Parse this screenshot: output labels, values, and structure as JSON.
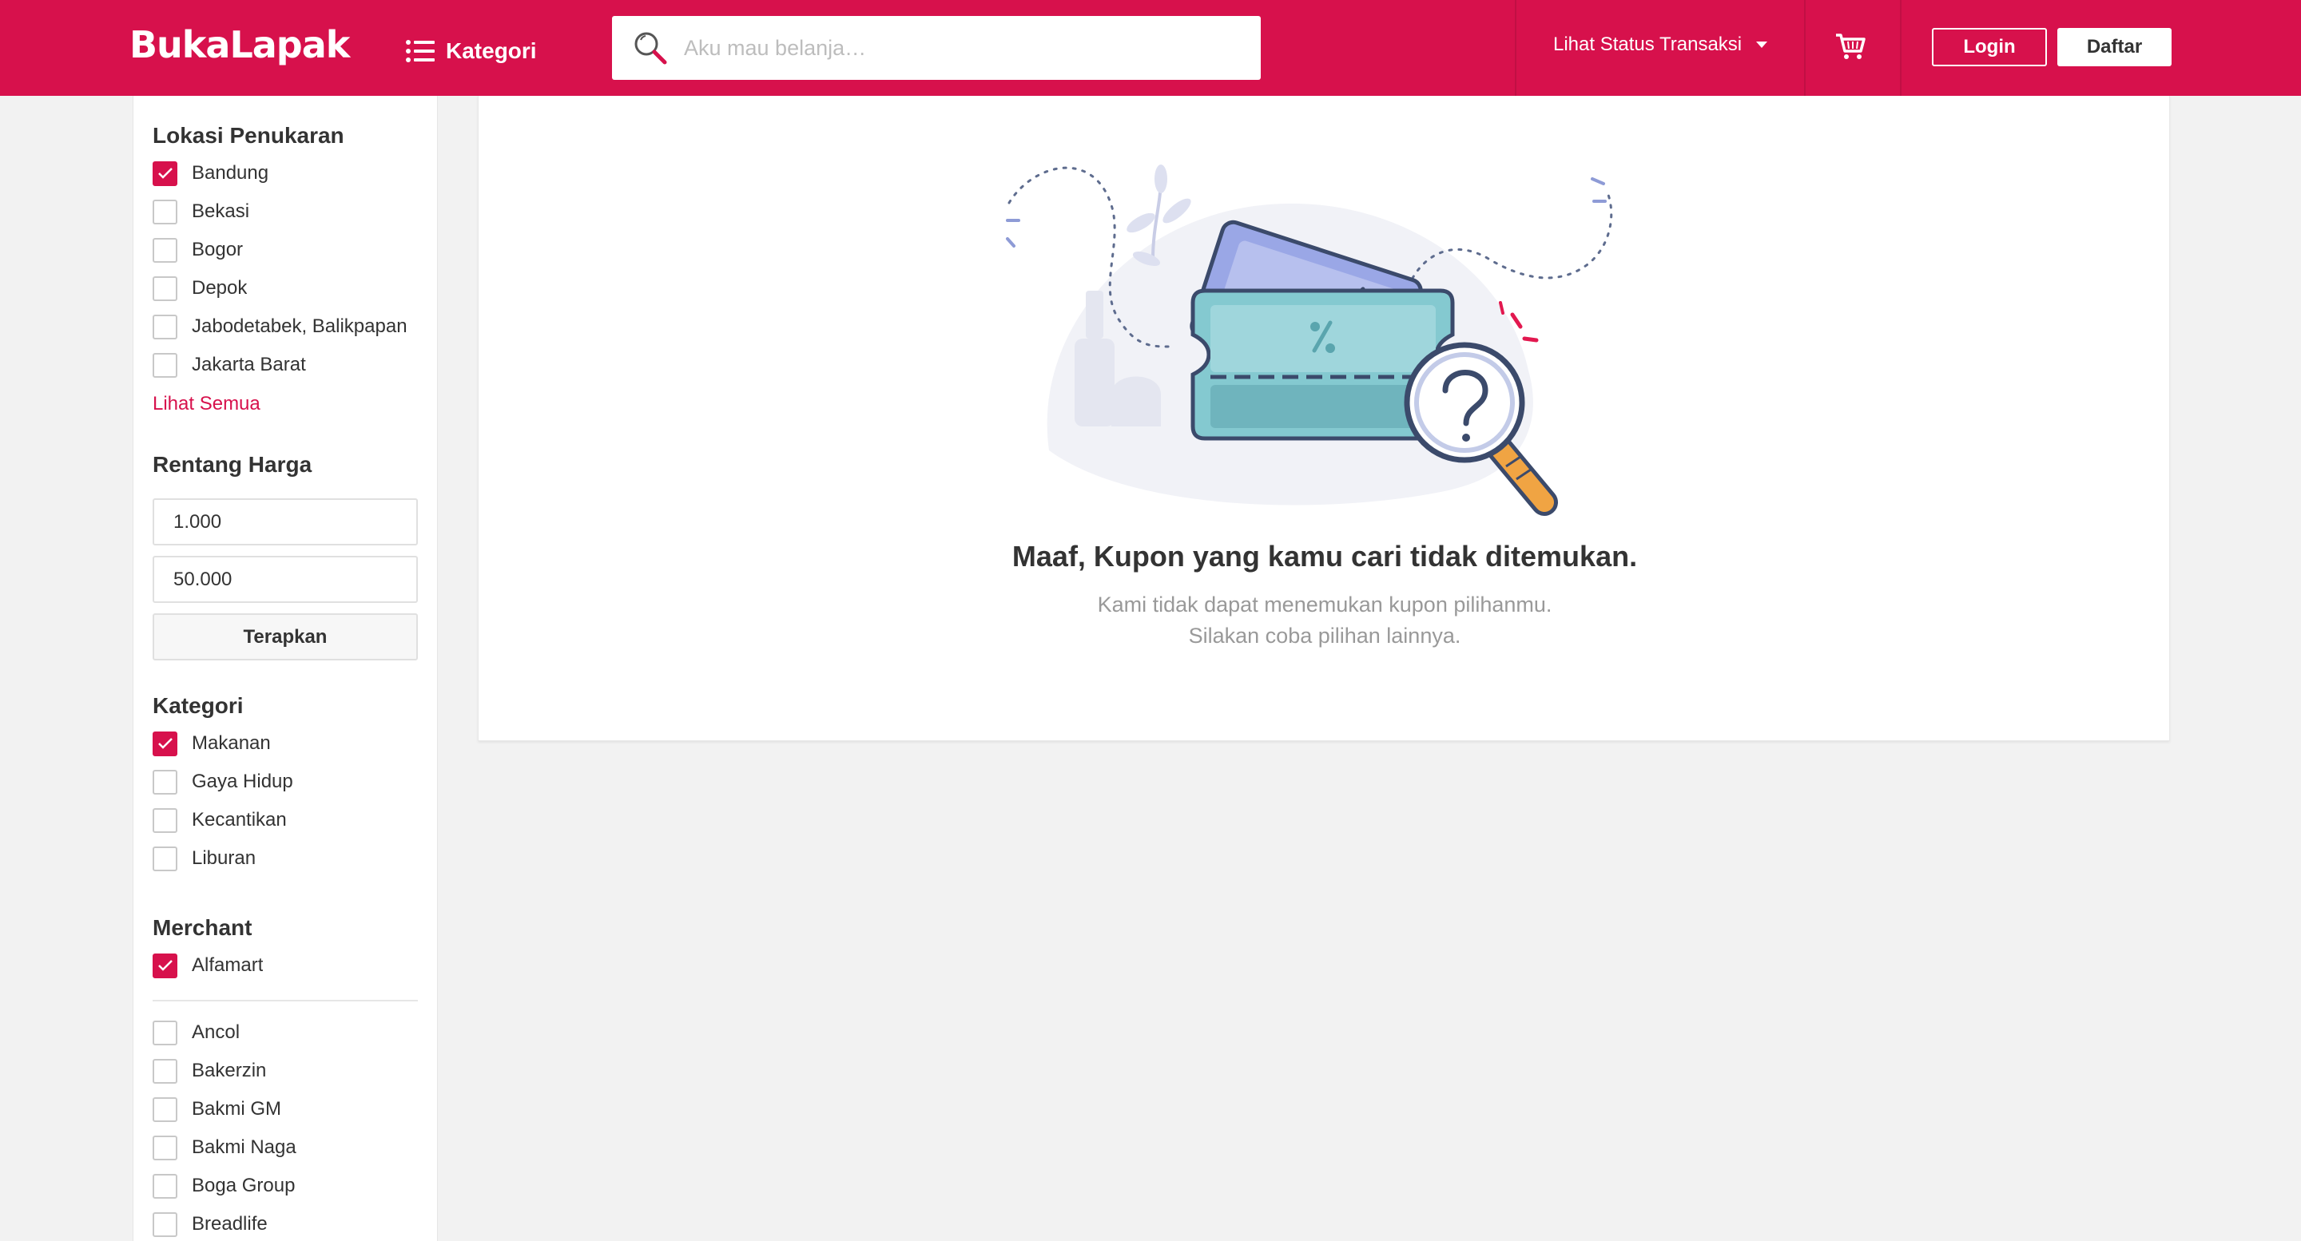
{
  "header": {
    "logo_text": "BukaLapak",
    "kategori_label": "Kategori",
    "search_placeholder": "Aku mau belanja…",
    "status_label": "Lihat Status Transaksi",
    "login_label": "Login",
    "daftar_label": "Daftar",
    "brand_color": "#d7114c"
  },
  "sidebar": {
    "lokasi": {
      "title": "Lokasi Penukaran",
      "items": [
        {
          "label": "Bandung",
          "checked": true
        },
        {
          "label": "Bekasi",
          "checked": false
        },
        {
          "label": "Bogor",
          "checked": false
        },
        {
          "label": "Depok",
          "checked": false
        },
        {
          "label": "Jabodetabek, Balikpapan",
          "checked": false
        },
        {
          "label": "Jakarta Barat",
          "checked": false
        }
      ],
      "see_all": "Lihat Semua"
    },
    "harga": {
      "title": "Rentang Harga",
      "min_value": "1.000",
      "max_value": "50.000",
      "apply_label": "Terapkan"
    },
    "kategori": {
      "title": "Kategori",
      "items": [
        {
          "label": "Makanan",
          "checked": true
        },
        {
          "label": "Gaya Hidup",
          "checked": false
        },
        {
          "label": "Kecantikan",
          "checked": false
        },
        {
          "label": "Liburan",
          "checked": false
        }
      ]
    },
    "merchant": {
      "title": "Merchant",
      "selected": [
        {
          "label": "Alfamart",
          "checked": true
        }
      ],
      "items": [
        {
          "label": "Ancol",
          "checked": false
        },
        {
          "label": "Bakerzin",
          "checked": false
        },
        {
          "label": "Bakmi GM",
          "checked": false
        },
        {
          "label": "Bakmi Naga",
          "checked": false
        },
        {
          "label": "Boga Group",
          "checked": false
        },
        {
          "label": "Breadlife",
          "checked": false
        }
      ]
    }
  },
  "main": {
    "empty_title": "Maaf, Kupon yang kamu cari tidak ditemukan.",
    "empty_line1": "Kami tidak dapat menemukan kupon pilihanmu.",
    "empty_line2": "Silakan coba pilihan lainnya."
  }
}
